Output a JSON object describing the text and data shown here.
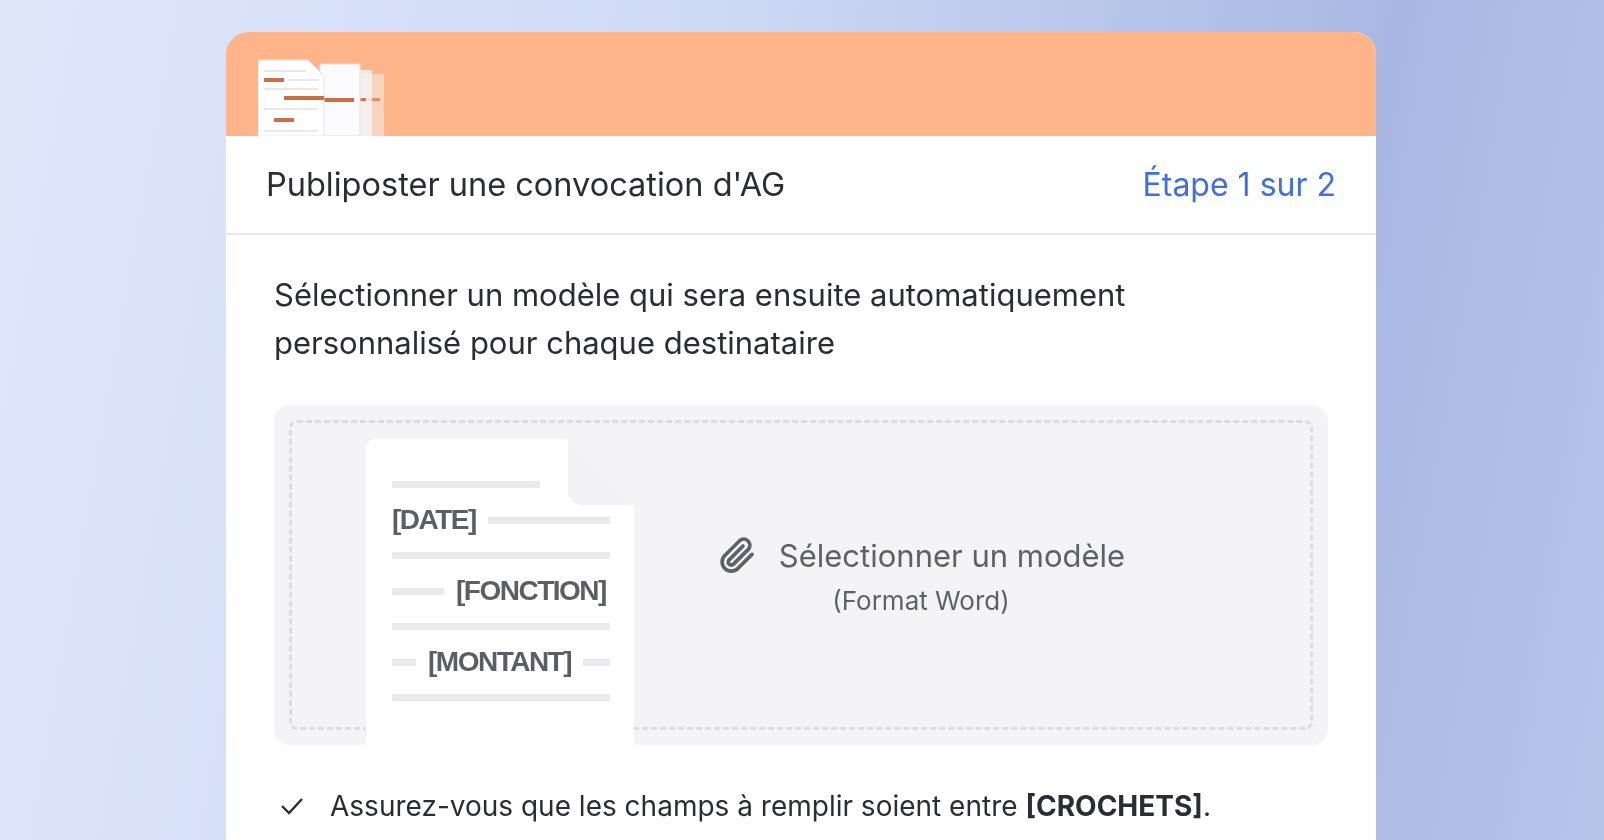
{
  "dialog": {
    "title": "Publiposter une convocation d'AG",
    "step": "Étape 1 sur 2"
  },
  "instructions": "Sélectionner un modèle qui sera ensuite automatiquement personnalisé pour chaque destinataire",
  "dropzone": {
    "document_fields": [
      "[DATE]",
      "[FONCTION]",
      "[MONTANT]"
    ],
    "label": "Sélectionner un modèle",
    "hint": "(Format Word)"
  },
  "tips": [
    {
      "text": "Assurez-vous que les champs à remplir soient entre **[CROCHETS]**."
    }
  ]
}
